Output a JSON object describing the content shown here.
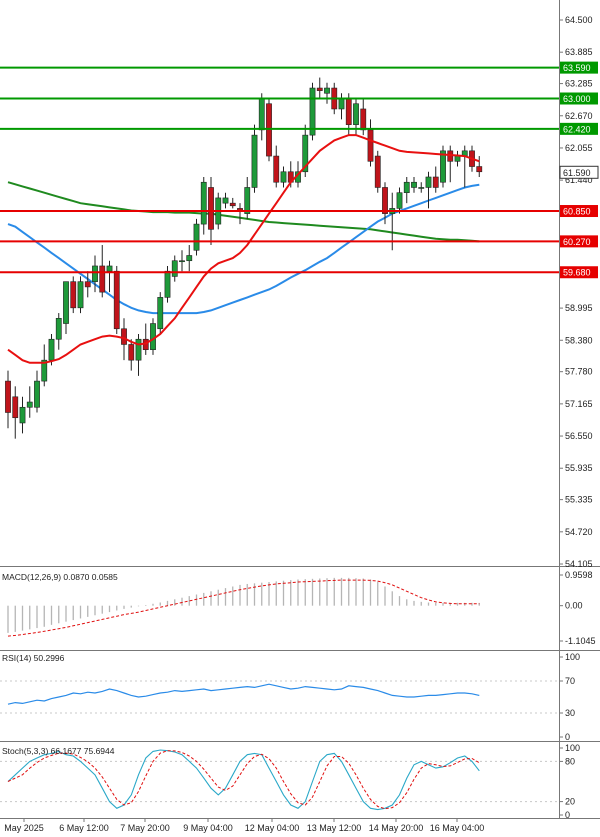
{
  "chart_data": [
    {
      "type": "candlestick",
      "ylim": [
        54.105,
        64.5
      ],
      "y_ticks": [
        "64.500",
        "63.885",
        "63.285",
        "62.670",
        "62.055",
        "61.440",
        "60.850",
        "60.270",
        "59.680",
        "58.995",
        "58.380",
        "57.780",
        "57.165",
        "56.550",
        "55.935",
        "55.335",
        "54.720",
        "54.105"
      ],
      "x_ticks": [
        "May 2025",
        "6 May 12:00",
        "7 May 20:00",
        "9 May 04:00",
        "12 May 04:00",
        "13 May 12:00",
        "14 May 20:00",
        "16 May 04:00"
      ],
      "current_price": "61.590",
      "levels": [
        {
          "value": 63.59,
          "label": "63.590",
          "color": "#009900"
        },
        {
          "value": 63.0,
          "label": "63.000",
          "color": "#009900"
        },
        {
          "value": 62.42,
          "label": "62.420",
          "color": "#009900"
        },
        {
          "value": 60.85,
          "label": "60.850",
          "color": "#e60000"
        },
        {
          "value": 60.27,
          "label": "60.270",
          "color": "#e60000"
        },
        {
          "value": 59.68,
          "label": "59.680",
          "color": "#e60000"
        }
      ],
      "candles": [
        {
          "o": 57.6,
          "h": 57.8,
          "l": 56.7,
          "c": 57.0
        },
        {
          "o": 57.3,
          "h": 57.5,
          "l": 56.5,
          "c": 56.9
        },
        {
          "o": 56.8,
          "h": 57.3,
          "l": 56.6,
          "c": 57.1
        },
        {
          "o": 57.1,
          "h": 57.5,
          "l": 56.9,
          "c": 57.2
        },
        {
          "o": 57.1,
          "h": 57.8,
          "l": 57.0,
          "c": 57.6
        },
        {
          "o": 57.6,
          "h": 58.3,
          "l": 57.5,
          "c": 58.0
        },
        {
          "o": 58.0,
          "h": 58.5,
          "l": 57.9,
          "c": 58.4
        },
        {
          "o": 58.4,
          "h": 58.9,
          "l": 58.2,
          "c": 58.8
        },
        {
          "o": 58.7,
          "h": 59.5,
          "l": 58.5,
          "c": 59.5
        },
        {
          "o": 59.5,
          "h": 59.6,
          "l": 58.9,
          "c": 59.0
        },
        {
          "o": 59.0,
          "h": 59.6,
          "l": 58.9,
          "c": 59.5
        },
        {
          "o": 59.5,
          "h": 59.7,
          "l": 59.2,
          "c": 59.4
        },
        {
          "o": 59.5,
          "h": 60.0,
          "l": 59.3,
          "c": 59.8
        },
        {
          "o": 59.8,
          "h": 60.2,
          "l": 59.2,
          "c": 59.3
        },
        {
          "o": 59.7,
          "h": 59.9,
          "l": 59.3,
          "c": 59.8
        },
        {
          "o": 59.7,
          "h": 59.8,
          "l": 58.5,
          "c": 58.6
        },
        {
          "o": 58.6,
          "h": 58.8,
          "l": 58.0,
          "c": 58.3
        },
        {
          "o": 58.3,
          "h": 58.4,
          "l": 57.8,
          "c": 58.0
        },
        {
          "o": 58.0,
          "h": 58.5,
          "l": 57.7,
          "c": 58.4
        },
        {
          "o": 58.4,
          "h": 58.7,
          "l": 58.1,
          "c": 58.2
        },
        {
          "o": 58.2,
          "h": 58.8,
          "l": 58.1,
          "c": 58.7
        },
        {
          "o": 58.6,
          "h": 59.3,
          "l": 58.5,
          "c": 59.2
        },
        {
          "o": 59.2,
          "h": 59.8,
          "l": 59.1,
          "c": 59.7
        },
        {
          "o": 59.6,
          "h": 60.0,
          "l": 59.5,
          "c": 59.9
        },
        {
          "o": 59.9,
          "h": 60.1,
          "l": 59.7,
          "c": 59.9
        },
        {
          "o": 59.9,
          "h": 60.2,
          "l": 59.7,
          "c": 60.0
        },
        {
          "o": 60.1,
          "h": 60.7,
          "l": 60.0,
          "c": 60.6
        },
        {
          "o": 60.6,
          "h": 61.5,
          "l": 60.4,
          "c": 61.4
        },
        {
          "o": 61.3,
          "h": 61.5,
          "l": 60.2,
          "c": 60.5
        },
        {
          "o": 60.6,
          "h": 61.2,
          "l": 60.5,
          "c": 61.1
        },
        {
          "o": 61.0,
          "h": 61.2,
          "l": 60.9,
          "c": 61.1
        },
        {
          "o": 61.0,
          "h": 61.1,
          "l": 60.9,
          "c": 60.95
        },
        {
          "o": 60.9,
          "h": 61.0,
          "l": 60.6,
          "c": 60.85
        },
        {
          "o": 60.8,
          "h": 61.5,
          "l": 60.7,
          "c": 61.3
        },
        {
          "o": 61.3,
          "h": 62.5,
          "l": 61.2,
          "c": 62.3
        },
        {
          "o": 62.4,
          "h": 63.1,
          "l": 62.2,
          "c": 63.0
        },
        {
          "o": 62.9,
          "h": 63.0,
          "l": 61.8,
          "c": 61.9
        },
        {
          "o": 61.9,
          "h": 62.1,
          "l": 61.3,
          "c": 61.4
        },
        {
          "o": 61.4,
          "h": 61.7,
          "l": 61.3,
          "c": 61.6
        },
        {
          "o": 61.6,
          "h": 61.8,
          "l": 61.3,
          "c": 61.4
        },
        {
          "o": 61.4,
          "h": 61.8,
          "l": 61.3,
          "c": 61.6
        },
        {
          "o": 61.6,
          "h": 62.5,
          "l": 61.5,
          "c": 62.3
        },
        {
          "o": 62.3,
          "h": 63.3,
          "l": 62.2,
          "c": 63.2
        },
        {
          "o": 63.2,
          "h": 63.4,
          "l": 63.0,
          "c": 63.15
        },
        {
          "o": 63.1,
          "h": 63.3,
          "l": 62.9,
          "c": 63.2
        },
        {
          "o": 63.2,
          "h": 63.3,
          "l": 62.7,
          "c": 62.8
        },
        {
          "o": 62.8,
          "h": 63.1,
          "l": 62.6,
          "c": 63.0
        },
        {
          "o": 63.0,
          "h": 63.1,
          "l": 62.3,
          "c": 62.5
        },
        {
          "o": 62.5,
          "h": 63.0,
          "l": 62.3,
          "c": 62.9
        },
        {
          "o": 62.8,
          "h": 63.0,
          "l": 62.3,
          "c": 62.4
        },
        {
          "o": 62.4,
          "h": 62.6,
          "l": 61.7,
          "c": 61.8
        },
        {
          "o": 61.9,
          "h": 62.0,
          "l": 61.2,
          "c": 61.3
        },
        {
          "o": 61.3,
          "h": 61.4,
          "l": 60.6,
          "c": 60.8
        },
        {
          "o": 60.8,
          "h": 61.2,
          "l": 60.1,
          "c": 60.9
        },
        {
          "o": 60.9,
          "h": 61.3,
          "l": 60.8,
          "c": 61.2
        },
        {
          "o": 61.2,
          "h": 61.5,
          "l": 61.0,
          "c": 61.4
        },
        {
          "o": 61.3,
          "h": 61.5,
          "l": 61.2,
          "c": 61.4
        },
        {
          "o": 61.3,
          "h": 61.4,
          "l": 61.2,
          "c": 61.3
        },
        {
          "o": 61.3,
          "h": 61.6,
          "l": 60.9,
          "c": 61.5
        },
        {
          "o": 61.5,
          "h": 61.7,
          "l": 61.2,
          "c": 61.3
        },
        {
          "o": 61.4,
          "h": 62.1,
          "l": 61.3,
          "c": 62.0
        },
        {
          "o": 62.0,
          "h": 62.1,
          "l": 61.4,
          "c": 61.8
        },
        {
          "o": 61.8,
          "h": 62.0,
          "l": 61.7,
          "c": 61.9
        },
        {
          "o": 61.9,
          "h": 62.1,
          "l": 61.3,
          "c": 62.0
        },
        {
          "o": 62.0,
          "h": 62.1,
          "l": 61.6,
          "c": 61.7
        },
        {
          "o": 61.7,
          "h": 61.9,
          "l": 61.5,
          "c": 61.6
        }
      ],
      "ma_red": [
        58.2,
        58.1,
        58.0,
        57.95,
        57.95,
        57.95,
        57.98,
        58.02,
        58.1,
        58.2,
        58.3,
        58.35,
        58.4,
        58.45,
        58.47,
        58.45,
        58.42,
        58.35,
        58.3,
        58.32,
        58.4,
        58.5,
        58.65,
        58.8,
        59.0,
        59.2,
        59.4,
        59.6,
        59.75,
        59.85,
        59.9,
        59.95,
        60.05,
        60.2,
        60.4,
        60.6,
        60.8,
        61.0,
        61.2,
        61.4,
        61.55,
        61.7,
        61.85,
        62.0,
        62.1,
        62.2,
        62.25,
        62.3,
        62.3,
        62.25,
        62.2,
        62.15,
        62.1,
        62.05,
        62.0,
        61.98,
        61.97,
        61.96,
        61.95,
        61.94,
        61.93,
        61.92,
        61.91,
        61.9,
        61.85,
        61.8
      ],
      "ma_blue": [
        60.6,
        60.55,
        60.45,
        60.35,
        60.25,
        60.15,
        60.05,
        59.95,
        59.85,
        59.75,
        59.65,
        59.55,
        59.45,
        59.35,
        59.25,
        59.15,
        59.07,
        59.0,
        58.95,
        58.92,
        58.9,
        58.9,
        58.9,
        58.9,
        58.9,
        58.9,
        58.9,
        58.92,
        58.95,
        59.0,
        59.05,
        59.1,
        59.15,
        59.2,
        59.25,
        59.3,
        59.35,
        59.42,
        59.5,
        59.58,
        59.65,
        59.72,
        59.8,
        59.88,
        59.95,
        60.05,
        60.15,
        60.25,
        60.35,
        60.45,
        60.55,
        60.65,
        60.72,
        60.8,
        60.85,
        60.9,
        60.95,
        61.0,
        61.05,
        61.1,
        61.15,
        61.2,
        61.25,
        61.3,
        61.33,
        61.35
      ],
      "ma_green": [
        61.4,
        61.36,
        61.32,
        61.28,
        61.24,
        61.2,
        61.16,
        61.12,
        61.08,
        61.04,
        61.0,
        60.98,
        60.96,
        60.94,
        60.92,
        60.9,
        60.88,
        60.86,
        60.85,
        60.84,
        60.83,
        60.83,
        60.83,
        60.82,
        60.82,
        60.82,
        60.81,
        60.8,
        60.8,
        60.78,
        60.76,
        60.74,
        60.72,
        60.7,
        60.68,
        60.66,
        60.64,
        60.63,
        60.62,
        60.61,
        60.6,
        60.59,
        60.58,
        60.57,
        60.56,
        60.55,
        60.54,
        60.53,
        60.52,
        60.51,
        60.5,
        60.48,
        60.46,
        60.44,
        60.42,
        60.4,
        60.38,
        60.36,
        60.34,
        60.32,
        60.31,
        60.3,
        60.3,
        60.29,
        60.28,
        60.27
      ]
    },
    {
      "type": "bar",
      "name": "macd",
      "label": "MACD(12,26,9) 0.0870 0.0585",
      "y_ticks": [
        "0.9598",
        "0.00",
        "-1.1045"
      ],
      "ylim": [
        -1.1045,
        0.9598
      ],
      "histogram": [
        -0.85,
        -0.82,
        -0.78,
        -0.74,
        -0.7,
        -0.66,
        -0.6,
        -0.55,
        -0.5,
        -0.45,
        -0.4,
        -0.35,
        -0.3,
        -0.25,
        -0.2,
        -0.15,
        -0.1,
        -0.06,
        -0.02,
        0.02,
        0.06,
        0.1,
        0.15,
        0.2,
        0.25,
        0.3,
        0.35,
        0.4,
        0.45,
        0.5,
        0.55,
        0.6,
        0.65,
        0.68,
        0.7,
        0.72,
        0.74,
        0.76,
        0.78,
        0.8,
        0.82,
        0.83,
        0.84,
        0.85,
        0.86,
        0.87,
        0.87,
        0.87,
        0.86,
        0.85,
        0.82,
        0.75,
        0.6,
        0.45,
        0.3,
        0.2,
        0.15,
        0.12,
        0.1,
        0.09,
        0.09,
        0.09,
        0.09,
        0.09,
        0.09,
        0.087
      ],
      "signal": [
        -0.95,
        -0.93,
        -0.9,
        -0.87,
        -0.84,
        -0.8,
        -0.76,
        -0.72,
        -0.68,
        -0.63,
        -0.58,
        -0.53,
        -0.48,
        -0.43,
        -0.38,
        -0.33,
        -0.28,
        -0.24,
        -0.2,
        -0.15,
        -0.1,
        -0.05,
        0.0,
        0.05,
        0.1,
        0.15,
        0.2,
        0.25,
        0.3,
        0.35,
        0.4,
        0.45,
        0.5,
        0.54,
        0.58,
        0.62,
        0.65,
        0.68,
        0.7,
        0.72,
        0.74,
        0.75,
        0.76,
        0.77,
        0.78,
        0.79,
        0.8,
        0.8,
        0.8,
        0.8,
        0.79,
        0.77,
        0.72,
        0.65,
        0.55,
        0.45,
        0.35,
        0.25,
        0.18,
        0.12,
        0.09,
        0.07,
        0.06,
        0.06,
        0.06,
        0.0585
      ]
    },
    {
      "type": "line",
      "name": "rsi",
      "label": "RSI(14) 50.2996",
      "y_ticks": [
        "100",
        "70",
        "30",
        "0"
      ],
      "ylim": [
        0,
        100
      ],
      "values": [
        41,
        43,
        42,
        44,
        46,
        45,
        48,
        50,
        52,
        55,
        54,
        56,
        55,
        57,
        60,
        58,
        55,
        52,
        50,
        51,
        53,
        55,
        56,
        58,
        57,
        58,
        59,
        60,
        58,
        59,
        60,
        61,
        62,
        63,
        62,
        64,
        66,
        64,
        62,
        60,
        61,
        63,
        62,
        61,
        60,
        59,
        60,
        64,
        63,
        62,
        60,
        58,
        55,
        52,
        51,
        50,
        50,
        51,
        52,
        52,
        53,
        54,
        55,
        55,
        54,
        52
      ]
    },
    {
      "type": "line",
      "name": "stoch",
      "label": "Stoch(5,3,3) 66.1677 75.6944",
      "y_ticks": [
        "100",
        "80",
        "20",
        "0"
      ],
      "ylim": [
        0,
        100
      ],
      "k": [
        50,
        60,
        70,
        80,
        85,
        90,
        92,
        95,
        90,
        88,
        80,
        70,
        60,
        40,
        20,
        10,
        15,
        30,
        60,
        85,
        95,
        97,
        96,
        94,
        90,
        80,
        70,
        55,
        40,
        30,
        40,
        60,
        80,
        90,
        92,
        90,
        70,
        50,
        30,
        15,
        10,
        20,
        50,
        80,
        90,
        92,
        80,
        60,
        40,
        20,
        10,
        8,
        10,
        15,
        30,
        55,
        75,
        80,
        75,
        70,
        72,
        78,
        85,
        88,
        80,
        66
      ]
    }
  ]
}
